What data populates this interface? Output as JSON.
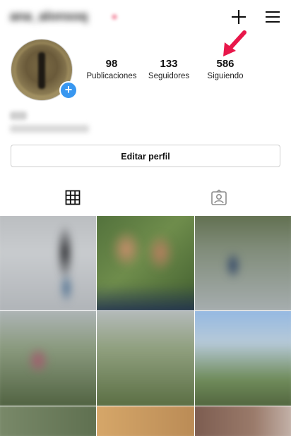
{
  "header": {
    "username": "ana_alonsoq",
    "plus_icon": "plus-icon",
    "menu_icon": "hamburger-menu-icon"
  },
  "profile": {
    "avatar_badge": "+",
    "stats": {
      "posts": {
        "value": "98",
        "label": "Publicaciones"
      },
      "followers": {
        "value": "133",
        "label": "Seguidores"
      },
      "following": {
        "value": "586",
        "label": "Siguiendo"
      }
    },
    "edit_button_label": "Editar perfil"
  },
  "annotation": {
    "arrow_color": "#e8174a"
  },
  "tabs": [
    {
      "icon": "grid-icon",
      "active": true
    },
    {
      "icon": "tagged-icon",
      "active": false
    }
  ],
  "colors": {
    "accent": "#3897f0",
    "text": "#111111",
    "border": "#cfcfcf"
  }
}
